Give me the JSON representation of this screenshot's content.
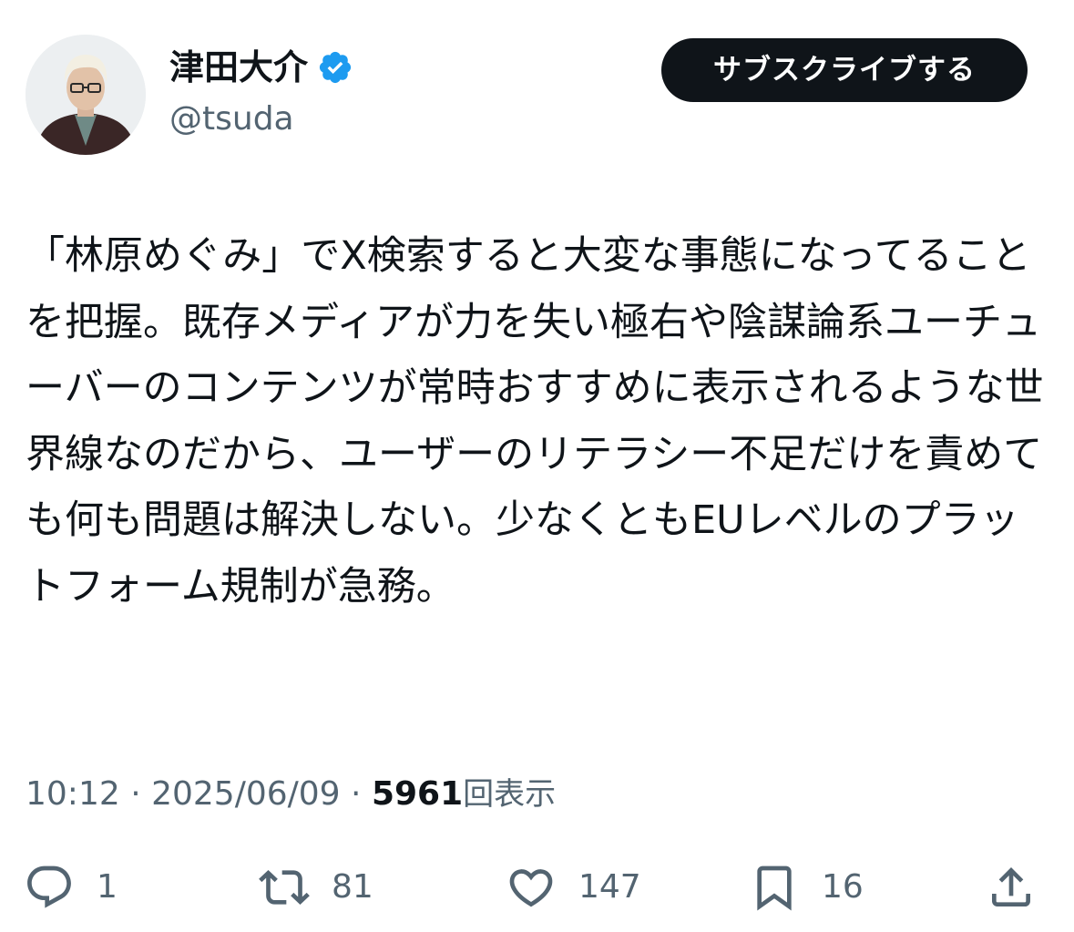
{
  "author": {
    "display_name": "津田大介",
    "handle": "@tsuda",
    "verified": true,
    "verified_color": "#1d9bf0"
  },
  "subscribe_button": {
    "label": "サブスクライブする"
  },
  "tweet": {
    "text": "「林原めぐみ」でX検索すると大変な事態になってることを把握。既存メディアが力を失い極右や陰謀論系ユーチューバーのコンテンツが常時おすすめに表示されるような世界線なのだから、ユーザーのリテラシー不足だけを責めても何も問題は解決しない。少なくともEUレベルのプラットフォーム規制が急務。"
  },
  "meta": {
    "time": "10:12",
    "separator": " · ",
    "date": "2025/06/09",
    "views_count": "5961",
    "views_label": "回表示"
  },
  "actions": {
    "reply": {
      "icon": "reply-icon",
      "count": "1"
    },
    "retweet": {
      "icon": "retweet-icon",
      "count": "81"
    },
    "like": {
      "icon": "heart-icon",
      "count": "147"
    },
    "bookmark": {
      "icon": "bookmark-icon",
      "count": "16"
    },
    "share": {
      "icon": "share-icon"
    }
  },
  "colors": {
    "text_primary": "#0f1419",
    "text_secondary": "#536471",
    "button_bg": "#0f1419",
    "button_text": "#ffffff",
    "background": "#ffffff"
  }
}
